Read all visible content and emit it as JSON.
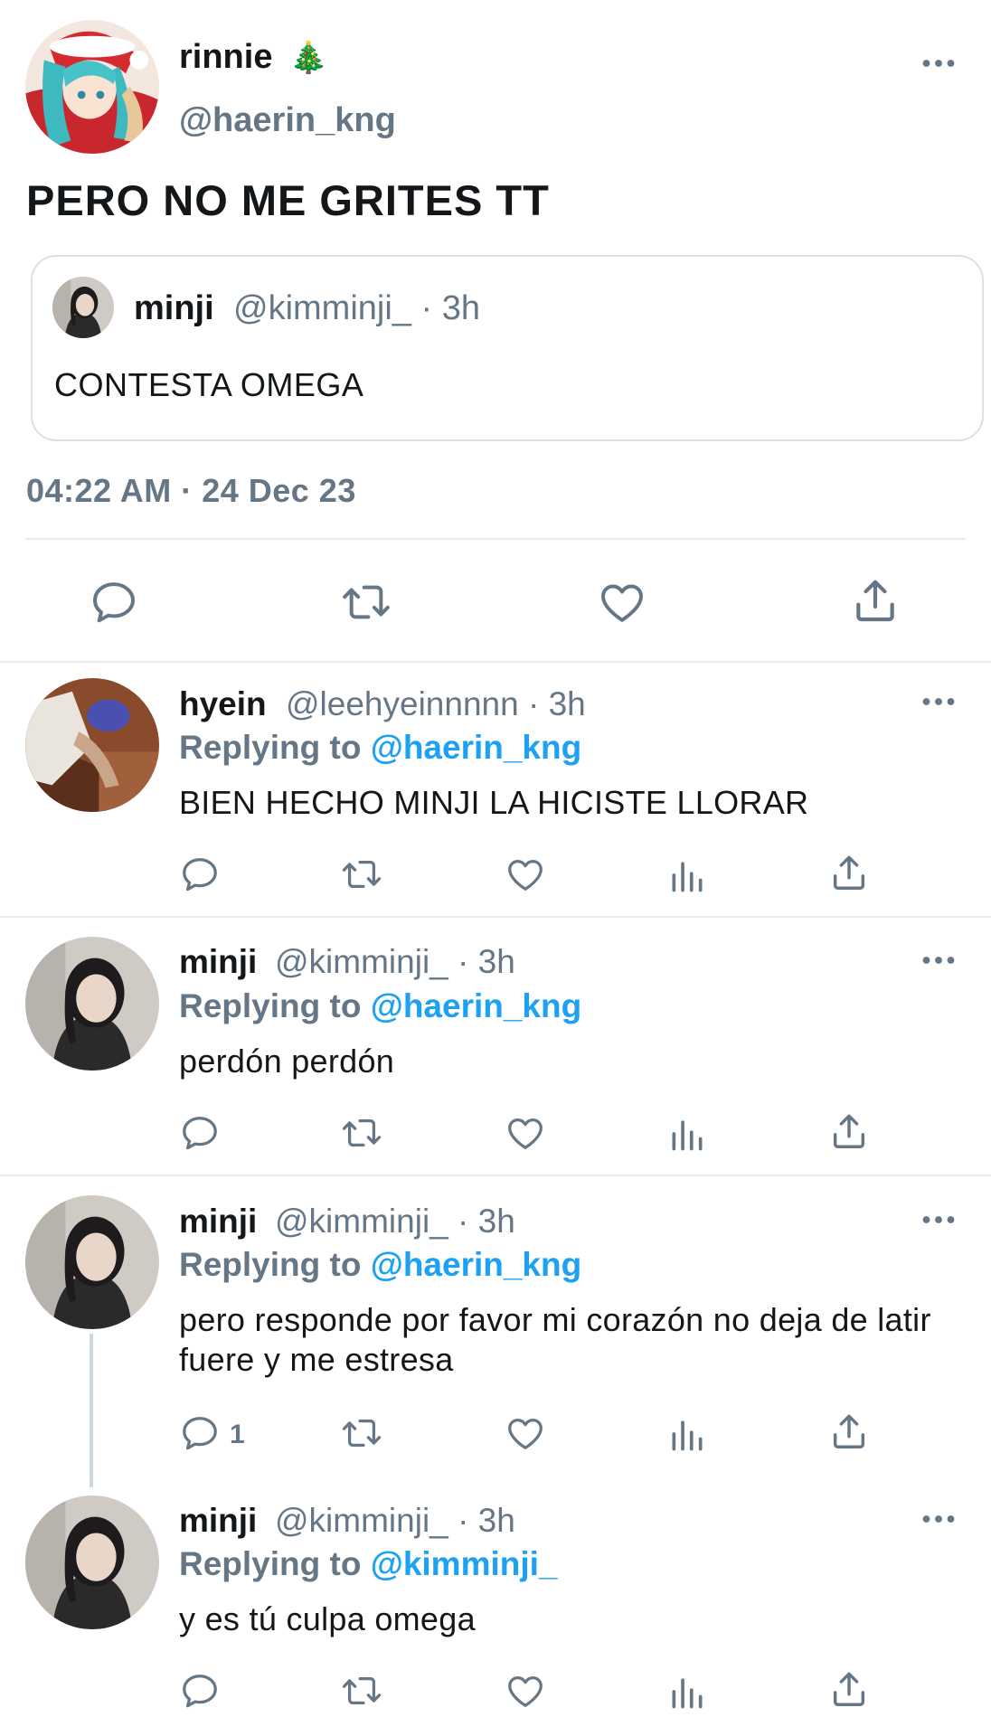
{
  "main_tweet": {
    "author_name": "rinnie",
    "author_emoji": "🎄",
    "author_handle": "@haerin_kng",
    "text": "PERO NO ME GRITES TT",
    "quoted": {
      "author_name": "minji",
      "handle_time": "@kimminji_ · 3h",
      "text": "CONTESTA OMEGA"
    },
    "timestamp": "04:22 AM · 24 Dec 23"
  },
  "replies": [
    {
      "name": "hyein",
      "handle_time": "@leehyeinnnnn · 3h",
      "replying_prefix": "Replying to ",
      "replying_to": "@haerin_kng",
      "text": "BIEN HECHO MINJI LA HICISTE LLORAR",
      "reply_count": ""
    },
    {
      "name": "minji",
      "handle_time": "@kimminji_ · 3h",
      "replying_prefix": "Replying to ",
      "replying_to": "@haerin_kng",
      "text": "perdón perdón",
      "reply_count": ""
    },
    {
      "name": "minji",
      "handle_time": "@kimminji_ · 3h",
      "replying_prefix": "Replying to ",
      "replying_to": "@haerin_kng",
      "text": "pero responde por favor mi corazón no deja de latir fuere y me estresa",
      "reply_count": "1"
    },
    {
      "name": "minji",
      "handle_time": "@kimminji_ · 3h",
      "replying_prefix": "Replying to ",
      "replying_to": "@kimminji_",
      "text": "y es tú culpa omega",
      "reply_count": ""
    }
  ],
  "colors": {
    "mention": "#1da1f2",
    "secondary_text": "#657786",
    "primary_text": "#14171a",
    "divider": "#e6ecf0"
  },
  "icons": [
    "more-icon",
    "reply-icon",
    "retweet-icon",
    "like-icon",
    "analytics-icon",
    "share-icon"
  ]
}
